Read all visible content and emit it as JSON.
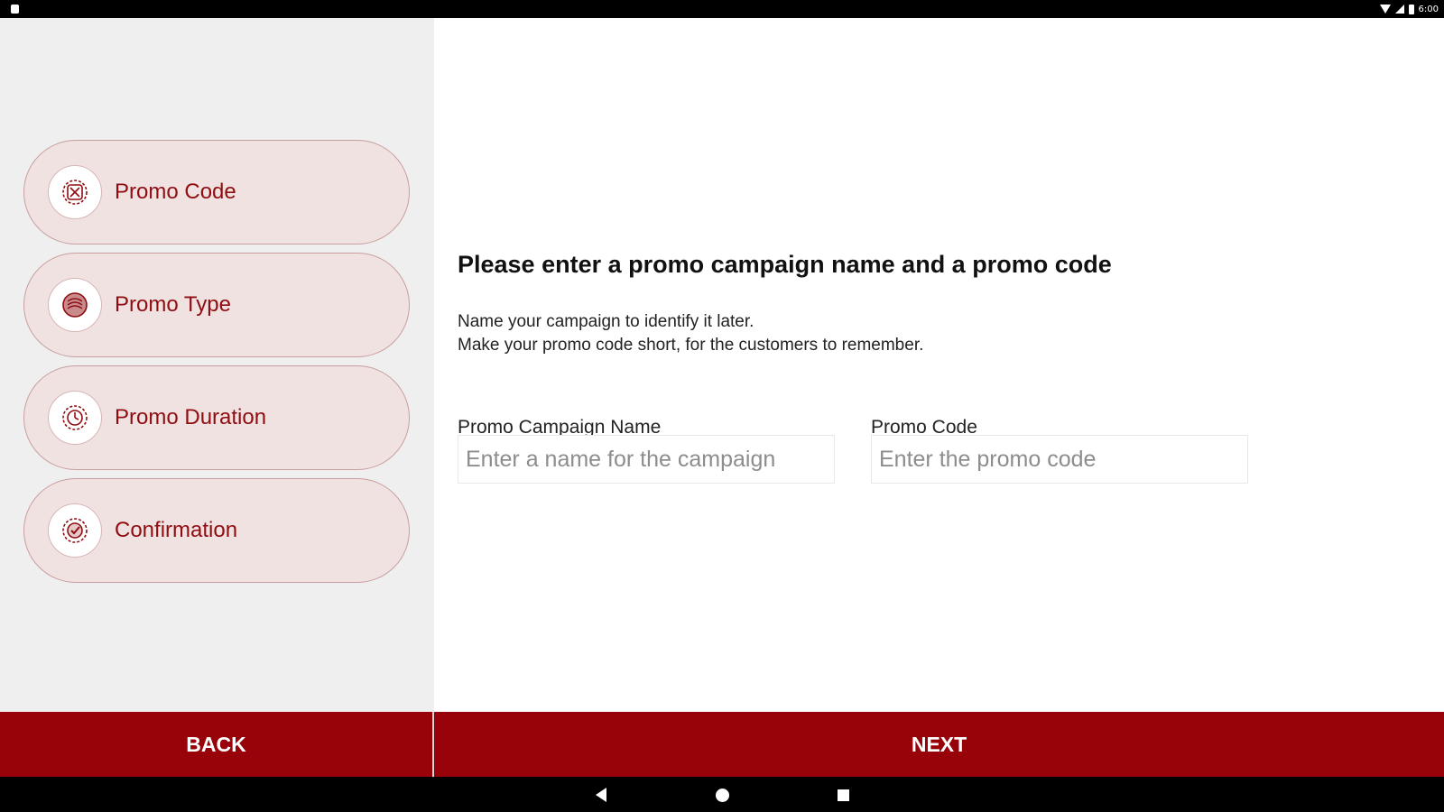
{
  "status_bar": {
    "time": "6:00"
  },
  "sidebar": {
    "steps": [
      {
        "label": "Promo Code",
        "icon": "promo-code-icon"
      },
      {
        "label": "Promo Type",
        "icon": "promo-type-icon"
      },
      {
        "label": "Promo Duration",
        "icon": "clock-icon"
      },
      {
        "label": "Confirmation",
        "icon": "checkmark-badge-icon"
      }
    ]
  },
  "main": {
    "heading": "Please enter a promo campaign name and a promo code",
    "description_line1": "Name your campaign to identify it later.",
    "description_line2": "Make your promo code short, for the customers to remember.",
    "campaign_field": {
      "label": "Promo Campaign Name",
      "placeholder": "Enter a name for the campaign",
      "value": ""
    },
    "code_field": {
      "label": "Promo Code",
      "placeholder": "Enter the promo code",
      "value": ""
    }
  },
  "footer": {
    "back_label": "BACK",
    "next_label": "NEXT"
  },
  "colors": {
    "accent": "#98030a",
    "step_background": "#f1e2e2",
    "step_text": "#8f0d11",
    "sidebar_background": "#efefef"
  }
}
